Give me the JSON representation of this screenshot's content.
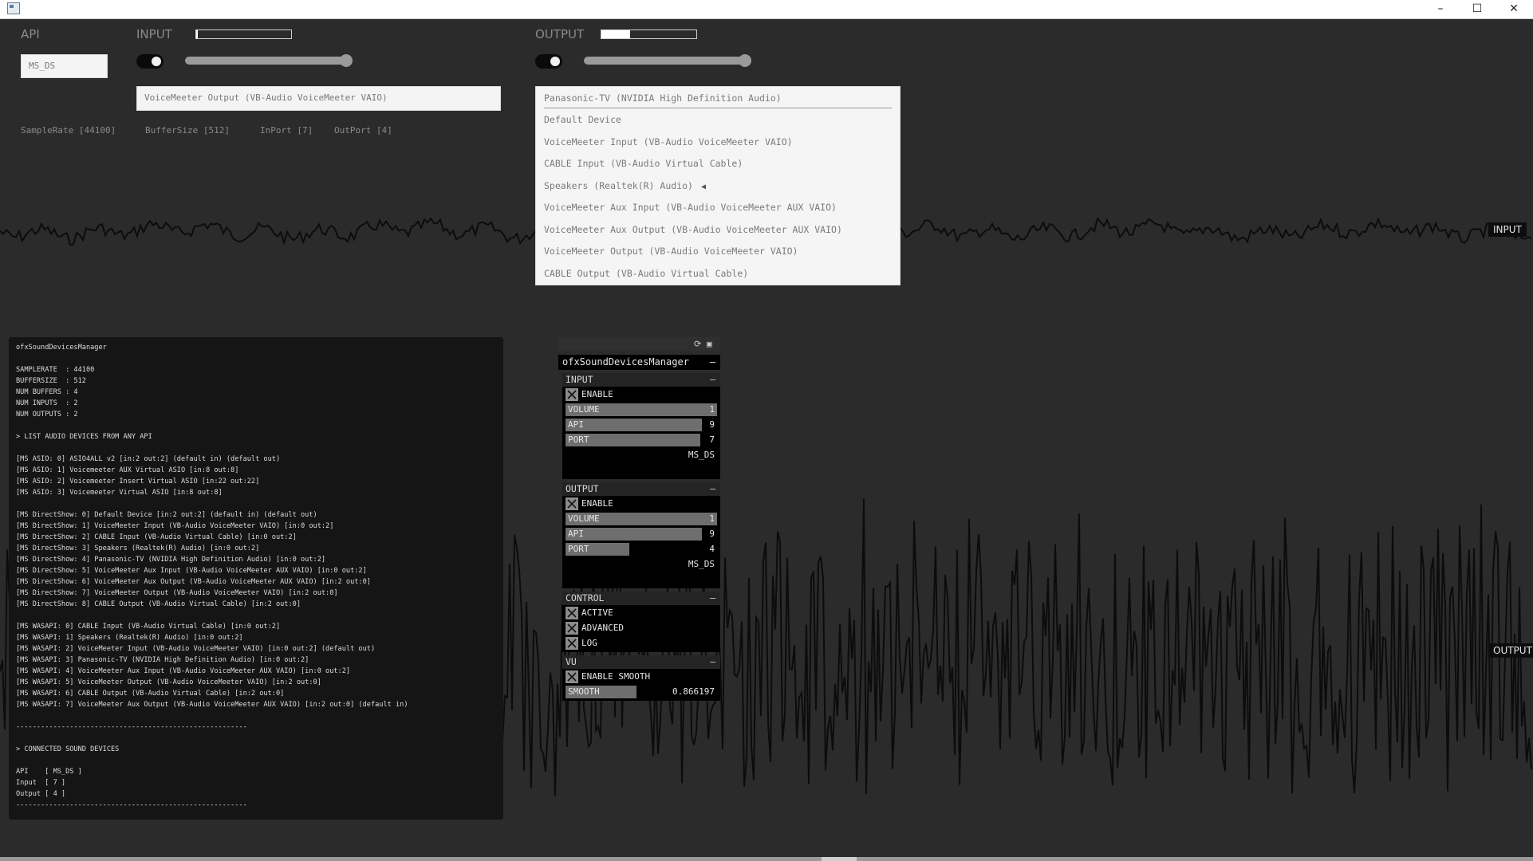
{
  "window": {
    "minimize": "–",
    "maximize": "☐",
    "close": "✕"
  },
  "api": {
    "label": "API",
    "value": "MS_DS"
  },
  "input": {
    "label": "INPUT",
    "meter_level": 0.02,
    "enabled": true,
    "volume_level": 1.0,
    "device": "VoiceMeeter Output (VB-Audio VoiceMeeter VAIO)"
  },
  "output": {
    "label": "OUTPUT",
    "meter_level": 0.3,
    "enabled": true,
    "volume_level": 1.0
  },
  "info": {
    "samplerate": "SampleRate [44100]",
    "buffersize": "BufferSize [512]",
    "inport": "InPort [7]",
    "outport": "OutPort [4]"
  },
  "device_list": [
    "Panasonic-TV (NVIDIA High Definition Audio)",
    "Default Device",
    "VoiceMeeter Input (VB-Audio VoiceMeeter VAIO)",
    "CABLE Input (VB-Audio Virtual Cable)",
    "Speakers (Realtek(R) Audio)",
    "VoiceMeeter Aux Input (VB-Audio VoiceMeeter AUX VAIO)",
    "VoiceMeeter Aux Output (VB-Audio VoiceMeeter AUX VAIO)",
    "VoiceMeeter Output (VB-Audio VoiceMeeter VAIO)",
    "CABLE Output (VB-Audio Virtual Cable)"
  ],
  "wave_tags": {
    "input": "INPUT",
    "output": "OUTPUT"
  },
  "console": [
    "ofxSoundDevicesManager",
    "",
    "SAMPLERATE  : 44100",
    "BUFFERSIZE  : 512",
    "NUM BUFFERS : 4",
    "NUM INPUTS  : 2",
    "NUM OUTPUTS : 2",
    "",
    "> LIST AUDIO DEVICES FROM ANY API",
    "",
    "[MS ASIO: 0] ASIO4ALL v2 [in:2 out:2] (default in) (default out)",
    "[MS ASIO: 1] Voicemeeter AUX Virtual ASIO [in:8 out:8]",
    "[MS ASIO: 2] Voicemeeter Insert Virtual ASIO [in:22 out:22]",
    "[MS ASIO: 3] Voicemeeter Virtual ASIO [in:8 out:8]",
    "",
    "[MS DirectShow: 0] Default Device [in:2 out:2] (default in) (default out)",
    "[MS DirectShow: 1] VoiceMeeter Input (VB-Audio VoiceMeeter VAIO) [in:0 out:2]",
    "[MS DirectShow: 2] CABLE Input (VB-Audio Virtual Cable) [in:0 out:2]",
    "[MS DirectShow: 3] Speakers (Realtek(R) Audio) [in:0 out:2]",
    "[MS DirectShow: 4] Panasonic-TV (NVIDIA High Definition Audio) [in:0 out:2]",
    "[MS DirectShow: 5] VoiceMeeter Aux Input (VB-Audio VoiceMeeter AUX VAIO) [in:0 out:2]",
    "[MS DirectShow: 6] VoiceMeeter Aux Output (VB-Audio VoiceMeeter AUX VAIO) [in:2 out:0]",
    "[MS DirectShow: 7] VoiceMeeter Output (VB-Audio VoiceMeeter VAIO) [in:2 out:0]",
    "[MS DirectShow: 8] CABLE Output (VB-Audio Virtual Cable) [in:2 out:0]",
    "",
    "[MS WASAPI: 0] CABLE Input (VB-Audio Virtual Cable) [in:0 out:2]",
    "[MS WASAPI: 1] Speakers (Realtek(R) Audio) [in:0 out:2]",
    "[MS WASAPI: 2] VoiceMeeter Input (VB-Audio VoiceMeeter VAIO) [in:0 out:2] (default out)",
    "[MS WASAPI: 3] Panasonic-TV (NVIDIA High Definition Audio) [in:0 out:2]",
    "[MS WASAPI: 4] VoiceMeeter Aux Input (VB-Audio VoiceMeeter AUX VAIO) [in:0 out:2]",
    "[MS WASAPI: 5] VoiceMeeter Output (VB-Audio VoiceMeeter VAIO) [in:2 out:0]",
    "[MS WASAPI: 6] CABLE Output (VB-Audio Virtual Cable) [in:2 out:0]",
    "[MS WASAPI: 7] VoiceMeeter Aux Output (VB-Audio VoiceMeeter AUX VAIO) [in:2 out:0] (default in)",
    "",
    "--------------------------------------------------------",
    "",
    "> CONNECTED SOUND DEVICES",
    "",
    "API    [ MS_DS ]",
    "Input  [ 7 ]",
    "Output [ 4 ]",
    "--------------------------------------------------------"
  ],
  "gui": {
    "title": "ofxSoundDevicesManager",
    "minus": "–",
    "refresh_glyph": "⟳",
    "save_glyph": "▣",
    "input": {
      "header": "INPUT",
      "enable": "ENABLE",
      "volume_label": "VOLUME",
      "volume_value": "1",
      "volume_fill": 1.0,
      "api_label": "API",
      "api_value": "9",
      "api_fill": 0.9,
      "port_label": "PORT",
      "port_value": "7",
      "port_fill": 0.89,
      "api_name": "MS_DS"
    },
    "output": {
      "header": "OUTPUT",
      "enable": "ENABLE",
      "volume_label": "VOLUME",
      "volume_value": "1",
      "volume_fill": 1.0,
      "api_label": "API",
      "api_value": "9",
      "api_fill": 0.9,
      "port_label": "PORT",
      "port_value": "4",
      "port_fill": 0.42,
      "api_name": "MS_DS"
    },
    "control": {
      "header": "CONTROL",
      "active": "ACTIVE",
      "advanced": "ADVANCED",
      "log": "LOG"
    },
    "vu": {
      "header": "VU",
      "enable_smooth": "ENABLE SMOOTH",
      "smooth_label": "SMOOTH",
      "smooth_value": "0.866197",
      "smooth_fill": 0.47
    }
  }
}
